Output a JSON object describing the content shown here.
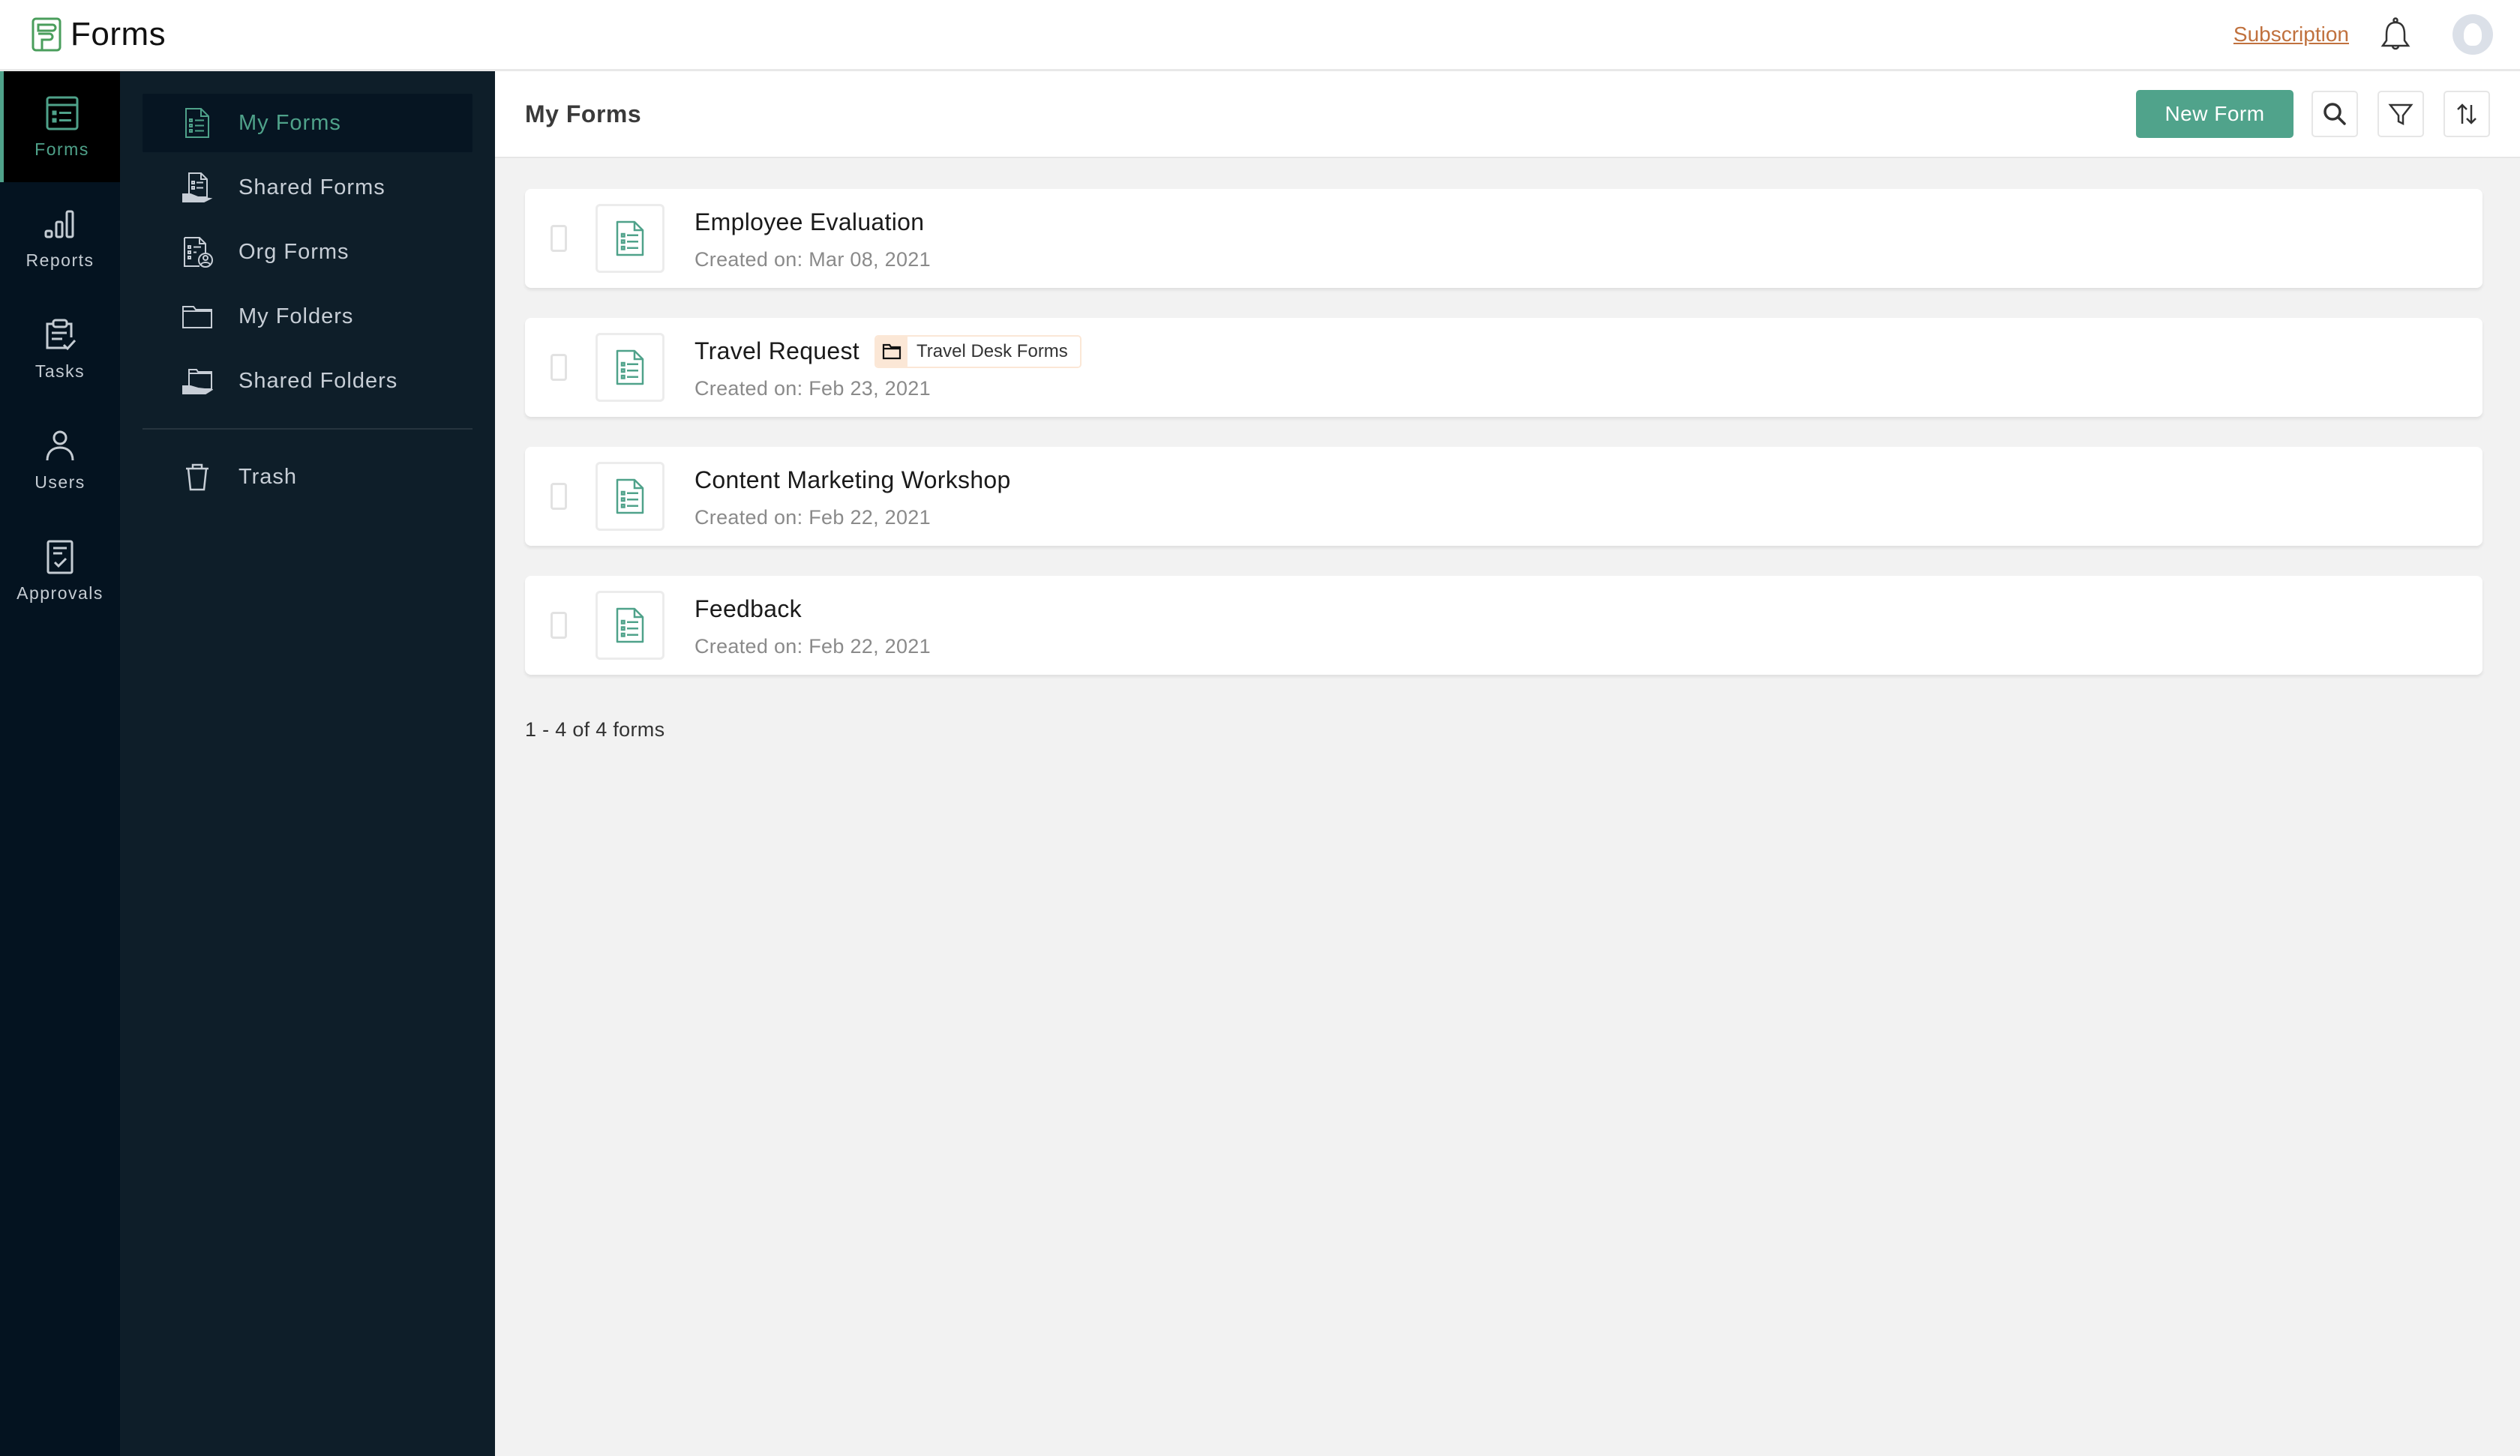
{
  "app": {
    "title": "Forms",
    "brand_color": "#4a9e5c",
    "accent_color": "#50a38b"
  },
  "topbar": {
    "subscription_label": "Subscription",
    "notifications_icon": "bell-icon",
    "avatar_icon": "user-avatar"
  },
  "rail": {
    "items": [
      {
        "label": "Forms",
        "icon": "forms-icon",
        "active": true
      },
      {
        "label": "Reports",
        "icon": "bar-chart-icon",
        "active": false
      },
      {
        "label": "Tasks",
        "icon": "clipboard-check-icon",
        "active": false
      },
      {
        "label": "Users",
        "icon": "user-icon",
        "active": false
      },
      {
        "label": "Approvals",
        "icon": "approval-icon",
        "active": false
      }
    ]
  },
  "subnav": {
    "items": [
      {
        "label": "My Forms",
        "icon": "form-document-icon",
        "active": true
      },
      {
        "label": "Shared Forms",
        "icon": "shared-form-icon",
        "active": false
      },
      {
        "label": "Org Forms",
        "icon": "org-form-icon",
        "active": false
      },
      {
        "label": "My Folders",
        "icon": "folder-icon",
        "active": false
      },
      {
        "label": "Shared Folders",
        "icon": "shared-folder-icon",
        "active": false
      }
    ],
    "trash_label": "Trash"
  },
  "main": {
    "title": "My Forms",
    "new_form_label": "New Form",
    "search_icon": "search-icon",
    "filter_icon": "filter-icon",
    "sort_icon": "sort-icon"
  },
  "forms": [
    {
      "name": "Employee Evaluation",
      "created_label": "Created on:",
      "created": "Mar 08, 2021",
      "folder": null
    },
    {
      "name": "Travel Request",
      "created_label": "Created on:",
      "created": "Feb 23, 2021",
      "folder": "Travel Desk Forms"
    },
    {
      "name": "Content Marketing Workshop",
      "created_label": "Created on:",
      "created": "Feb 22, 2021",
      "folder": null
    },
    {
      "name": "Feedback",
      "created_label": "Created on:",
      "created": "Feb 22, 2021",
      "folder": null
    }
  ],
  "pagination": {
    "text": "1 - 4 of 4 forms"
  }
}
